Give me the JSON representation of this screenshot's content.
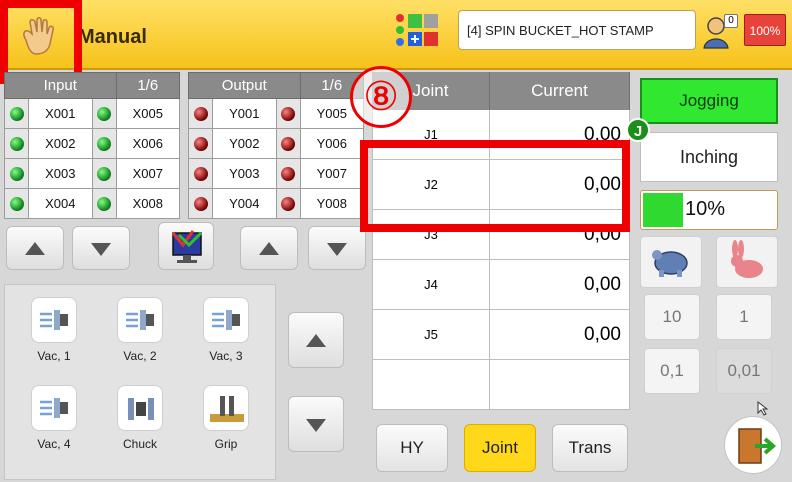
{
  "header": {
    "title": "Manual",
    "job_name": "[4] SPIN BUCKET_HOT STAMP",
    "user_badge": "0",
    "speed_indicator": "100%"
  },
  "input_panel": {
    "title": "Input",
    "page": "1/6",
    "rows": [
      {
        "left": "X001",
        "right": "X005"
      },
      {
        "left": "X002",
        "right": "X006"
      },
      {
        "left": "X003",
        "right": "X007"
      },
      {
        "left": "X004",
        "right": "X008"
      }
    ]
  },
  "output_panel": {
    "title": "Output",
    "page": "1/6",
    "rows": [
      {
        "left": "Y001",
        "right": "Y005"
      },
      {
        "left": "Y002",
        "right": "Y006"
      },
      {
        "left": "Y003",
        "right": "Y007"
      },
      {
        "left": "Y004",
        "right": "Y008"
      }
    ]
  },
  "tools": [
    {
      "label": "Vac, 1",
      "icon": "vacuum-icon"
    },
    {
      "label": "Vac, 2",
      "icon": "vacuum-icon"
    },
    {
      "label": "Vac, 3",
      "icon": "vacuum-icon"
    },
    {
      "label": "Vac, 4",
      "icon": "vacuum-icon"
    },
    {
      "label": "Chuck",
      "icon": "chuck-icon"
    },
    {
      "label": "Grip",
      "icon": "grip-icon"
    }
  ],
  "joint_table": {
    "col_joint": "Joint",
    "col_current": "Current",
    "rows": [
      {
        "joint": "J1",
        "value": "0,00"
      },
      {
        "joint": "J2",
        "value": "0,00"
      },
      {
        "joint": "J3",
        "value": "0,00"
      },
      {
        "joint": "J4",
        "value": "0,00"
      },
      {
        "joint": "J5",
        "value": "0,00"
      },
      {
        "joint": "",
        "value": ""
      }
    ]
  },
  "annotation_marker": "⑧",
  "modes": {
    "hy": "HY",
    "joint": "Joint",
    "trans": "Trans"
  },
  "right_panel": {
    "jogging": "Jogging",
    "inching": "Inching",
    "j_badge": "J",
    "speed_text": "10%",
    "speed_fraction": 0.1,
    "steps": [
      "10",
      "1",
      "0,1",
      "0,01"
    ]
  },
  "colors": {
    "header": "#f7c21a",
    "highlight": "#ee0000",
    "jog_active": "#30e830",
    "mode_active": "#ffd81a"
  }
}
